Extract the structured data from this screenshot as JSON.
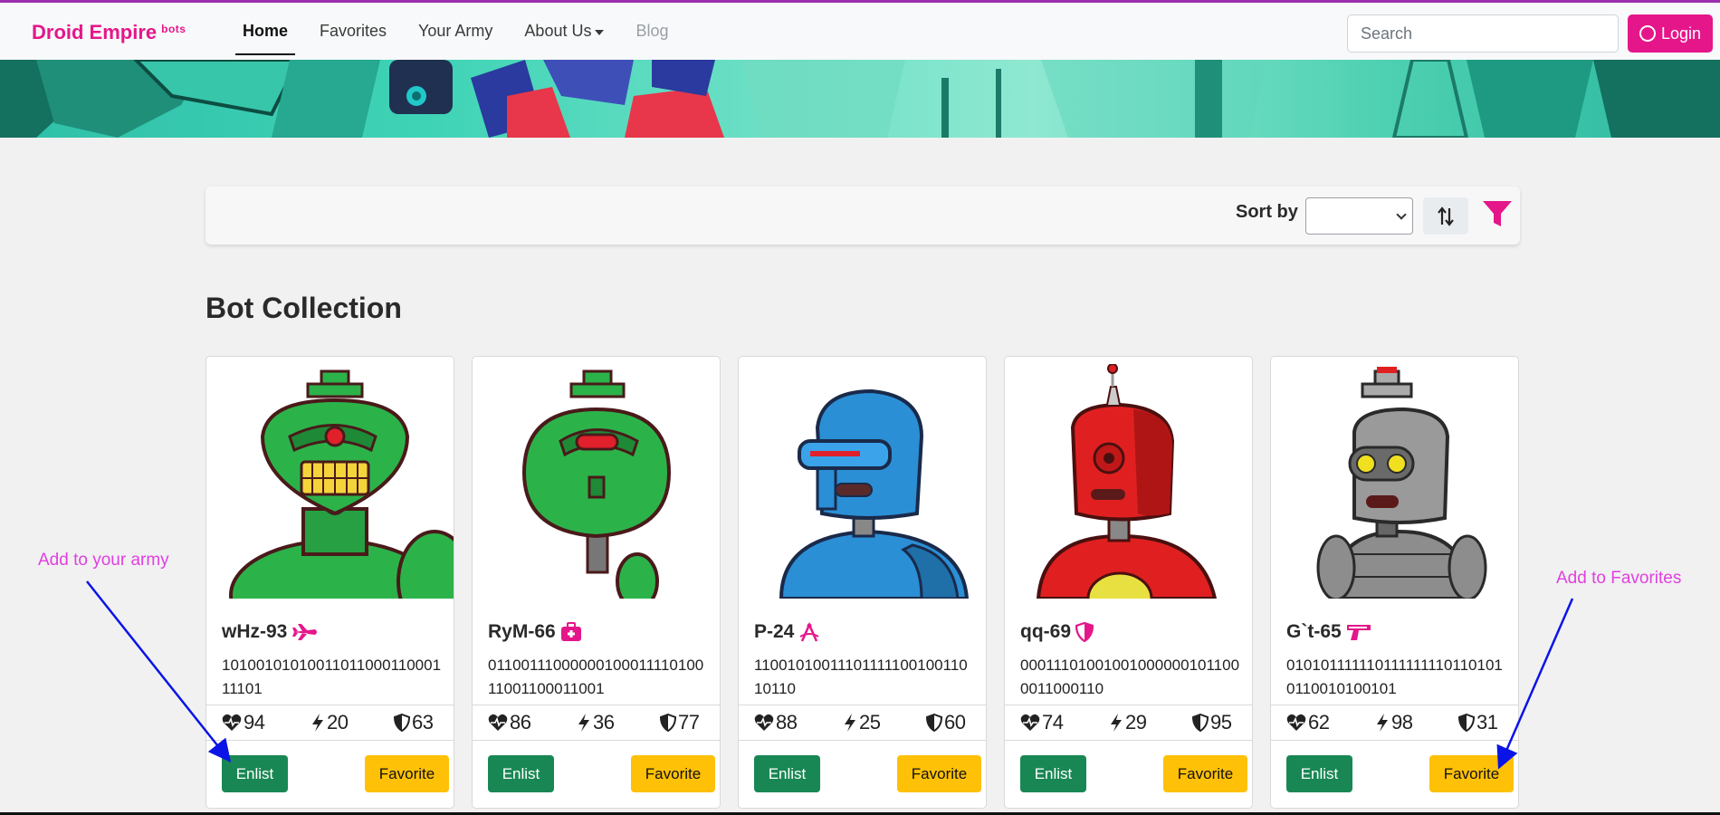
{
  "brand": {
    "name": "Droid Empire",
    "tag": "bots"
  },
  "nav": {
    "links": [
      {
        "label": "Home",
        "active": true
      },
      {
        "label": "Favorites"
      },
      {
        "label": "Your Army"
      },
      {
        "label": "About Us",
        "dropdown": true
      },
      {
        "label": "Blog",
        "disabled": true
      }
    ],
    "search_placeholder": "Search",
    "login_label": "Login"
  },
  "toolbar": {
    "sort_label": "Sort by",
    "sort_value": ""
  },
  "heading": "Bot Collection",
  "colors": {
    "brand": "#e5168a",
    "enlist": "#198754",
    "favorite": "#ffc107",
    "annotation": "#e040e0",
    "arrow": "#0a14e6"
  },
  "bots": [
    {
      "name": "wHz-93",
      "class_icon": "plane-icon",
      "code": "1010010101001101100011000111101",
      "health": 94,
      "damage": 20,
      "armor": 63,
      "color": "#2bb34a",
      "enlist_label": "Enlist",
      "favorite_label": "Favorite"
    },
    {
      "name": "RyM-66",
      "class_icon": "medkit-icon",
      "code": "0110011100000010001111010011001100011001",
      "health": 86,
      "damage": 36,
      "armor": 77,
      "color": "#2bb34a",
      "enlist_label": "Enlist",
      "favorite_label": "Favorite"
    },
    {
      "name": "P-24",
      "class_icon": "compass-icon",
      "code": "1100101001110111110010011010110",
      "health": 88,
      "damage": 25,
      "armor": 60,
      "color": "#2b8fd6",
      "enlist_label": "Enlist",
      "favorite_label": "Favorite"
    },
    {
      "name": "qq-69",
      "class_icon": "shield-icon",
      "code": "000111010010010000001011000011000110",
      "health": 74,
      "damage": 29,
      "armor": 95,
      "color": "#e02020",
      "enlist_label": "Enlist",
      "favorite_label": "Favorite"
    },
    {
      "name": "G`t-65",
      "class_icon": "gun-icon",
      "code": "0101011111101111111101101010110010100101",
      "health": 62,
      "damage": 98,
      "armor": 31,
      "color": "#8d8d8d",
      "enlist_label": "Enlist",
      "favorite_label": "Favorite"
    }
  ],
  "annotations": {
    "left": "Add to your army",
    "right": "Add to Favorites"
  }
}
